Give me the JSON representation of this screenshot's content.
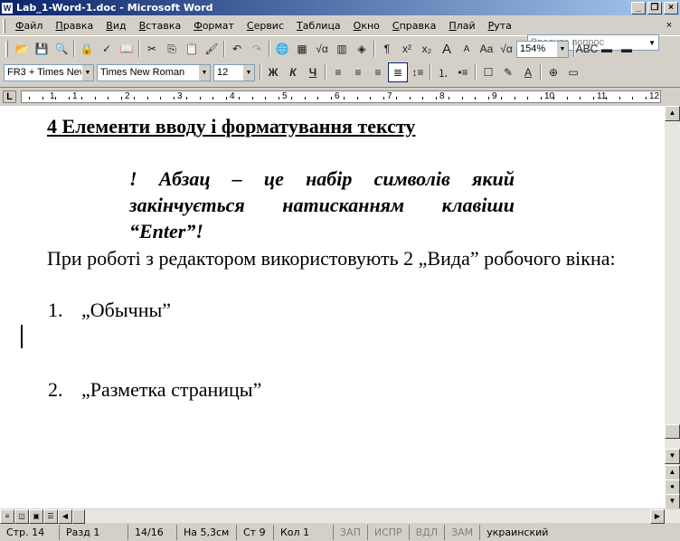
{
  "window": {
    "title": "Lab_1-Word-1.doc - Microsoft Word",
    "app_icon": "W"
  },
  "menu": {
    "items": [
      {
        "u": "Ф",
        "rest": "айл"
      },
      {
        "u": "П",
        "rest": "равка"
      },
      {
        "u": "В",
        "rest": "ид"
      },
      {
        "u": "В",
        "rest": "ставка"
      },
      {
        "u": "Ф",
        "rest": "ормат"
      },
      {
        "u": "С",
        "rest": "ервис"
      },
      {
        "u": "Т",
        "rest": "аблица"
      },
      {
        "u": "О",
        "rest": "кно"
      },
      {
        "u": "С",
        "rest": "правка"
      },
      {
        "u": "П",
        "rest": "лай"
      },
      {
        "u": "Р",
        "rest": "ута"
      }
    ],
    "help_placeholder": "Введите вопрос"
  },
  "toolbar": {
    "zoom": "154%",
    "style": "FR3 + Times Nev",
    "font": "Times New Roman",
    "size": "12",
    "bold": "Ж",
    "italic": "К",
    "underline": "Ч"
  },
  "ruler": {
    "numbers": [
      "1",
      "1",
      "2",
      "3",
      "4",
      "5",
      "6",
      "7",
      "8",
      "9",
      "10",
      "11",
      "12"
    ]
  },
  "document": {
    "heading": "4 Елементи вводу і форматування тексту",
    "callout": "! Абзац – це набір символів який закінчується натисканням клавіши “Enter”!",
    "paragraph": "При роботі з редактором використовують 2 „Вида” робочого вікна:",
    "list": [
      {
        "num": "1.",
        "text": "„Обычны”"
      },
      {
        "num": "2.",
        "text": "„Разметка страницы”"
      }
    ]
  },
  "status": {
    "page": "Стр. 14",
    "section": "Разд 1",
    "pages": "14/16",
    "at": "На 5,3см",
    "line": "Ст 9",
    "col": "Кол 1",
    "rec": "ЗАП",
    "trk": "ИСПР",
    "ext": "ВДЛ",
    "ovr": "ЗАМ",
    "lang": "украинский"
  }
}
